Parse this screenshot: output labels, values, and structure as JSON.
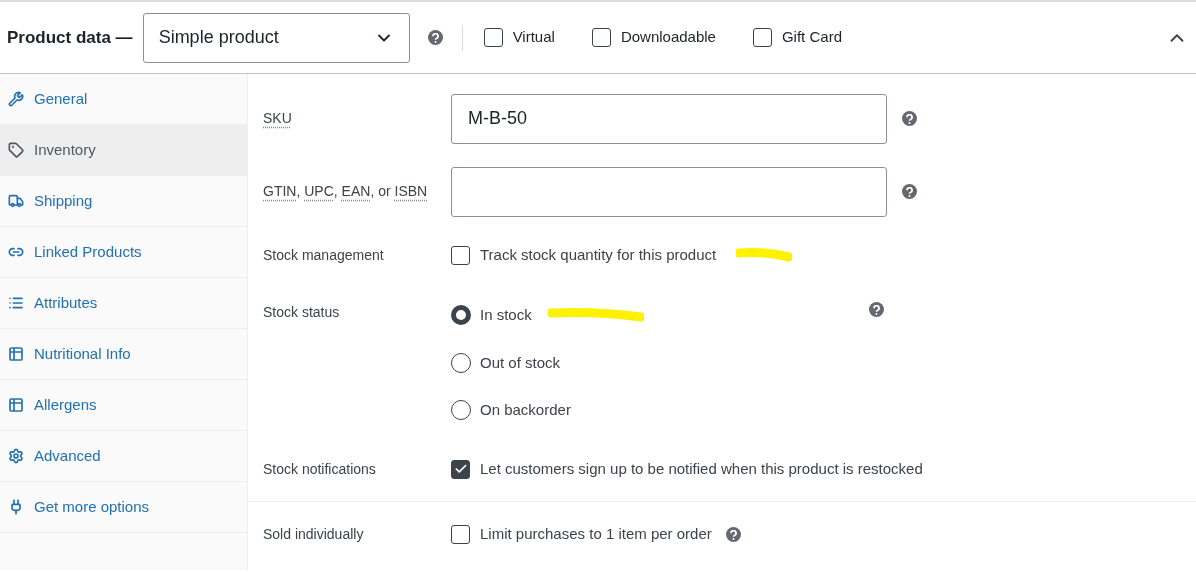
{
  "header": {
    "title": "Product data —",
    "product_type": "Simple product",
    "options": [
      {
        "label": "Virtual",
        "checked": false
      },
      {
        "label": "Downloadable",
        "checked": false
      },
      {
        "label": "Gift Card",
        "checked": false
      }
    ]
  },
  "tabs": [
    {
      "label": "General",
      "selected": false
    },
    {
      "label": "Inventory",
      "selected": true
    },
    {
      "label": "Shipping",
      "selected": false
    },
    {
      "label": "Linked Products",
      "selected": false
    },
    {
      "label": "Attributes",
      "selected": false
    },
    {
      "label": "Nutritional Info",
      "selected": false
    },
    {
      "label": "Allergens",
      "selected": false
    },
    {
      "label": "Advanced",
      "selected": false
    },
    {
      "label": "Get more options",
      "selected": false
    }
  ],
  "fields": [
    {
      "kind": "text",
      "label_parts": [
        {
          "text": "SKU",
          "abbr": true
        }
      ],
      "value": "M-B-50",
      "help": true
    },
    {
      "kind": "text",
      "label_parts": [
        {
          "text": "GTIN",
          "abbr": true
        },
        {
          "text": ", ",
          "abbr": false
        },
        {
          "text": "UPC",
          "abbr": true
        },
        {
          "text": ", ",
          "abbr": false
        },
        {
          "text": "EAN",
          "abbr": true
        },
        {
          "text": ", or ",
          "abbr": false
        },
        {
          "text": "ISBN",
          "abbr": true
        }
      ],
      "help": true
    },
    {
      "kind": "checkbox",
      "label_parts": [
        {
          "text": "Stock management",
          "abbr": false
        }
      ],
      "option": "Track stock quantity for this product",
      "checked": false,
      "highlighted": true
    },
    {
      "kind": "radio",
      "label_parts": [
        {
          "text": "Stock status",
          "abbr": false
        }
      ],
      "help": true,
      "options": [
        {
          "label": "In stock",
          "selected": true,
          "highlighted": true
        },
        {
          "label": "Out of stock",
          "selected": false,
          "highlighted": false
        },
        {
          "label": "On backorder",
          "selected": false,
          "highlighted": false
        }
      ]
    },
    {
      "kind": "checkbox",
      "label_parts": [
        {
          "text": "Stock notifications",
          "abbr": false
        }
      ],
      "option": "Let customers sign up to be notified when this product is restocked",
      "checked": true,
      "highlighted": false
    },
    {
      "kind": "checkbox",
      "label_parts": [
        {
          "text": "Sold individually",
          "abbr": false
        }
      ],
      "option": "Limit purchases to 1 item per order",
      "checked": false,
      "help": true,
      "divider_above": true
    }
  ]
}
